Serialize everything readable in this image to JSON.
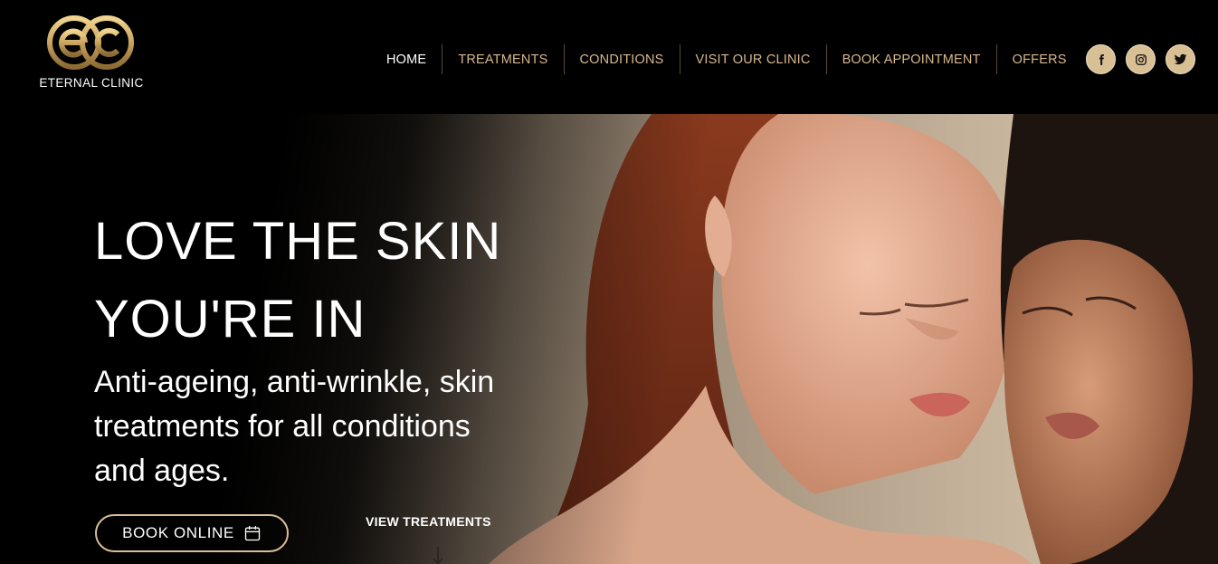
{
  "brand": {
    "monogram": "ec",
    "name": "ETERNAL CLINIC",
    "gold": "#cfae6b"
  },
  "nav": {
    "items": [
      {
        "label": "HOME",
        "active": true
      },
      {
        "label": "TREATMENTS"
      },
      {
        "label": "CONDITIONS"
      },
      {
        "label": "VISIT OUR CLINIC"
      },
      {
        "label": "BOOK APPOINTMENT"
      },
      {
        "label": "OFFERS"
      }
    ],
    "active_color": "#ffffff",
    "link_color": "#d8b88d"
  },
  "social": [
    {
      "icon": "facebook-icon"
    },
    {
      "icon": "instagram-icon"
    },
    {
      "icon": "twitter-icon"
    }
  ],
  "hero": {
    "headline_line1": "LOVE THE SKIN",
    "headline_line2": "YOU'RE IN",
    "subheadline": "Anti-ageing, anti-wrinkle, skin treatments for all conditions and ages.",
    "book_button": {
      "label": "BOOK ONLINE",
      "icon": "calendar-icon"
    },
    "view_link": "VIEW TREATMENTS",
    "image": "two-women-portrait-photo"
  }
}
